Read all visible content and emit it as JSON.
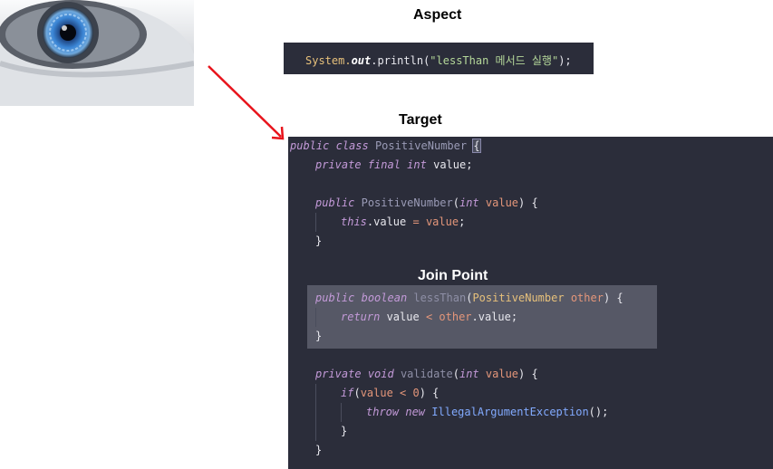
{
  "labels": {
    "aspect": "Aspect",
    "target": "Target",
    "join_point": "Join Point"
  },
  "aspect_code": {
    "part1": "System.",
    "part2": "out",
    "part3": ".println(",
    "part4": "\"lessThan 메서드 실행\"",
    "part5": ");"
  },
  "target_code": {
    "l1": {
      "kw1": "public",
      "kw2": "class",
      "name": "PositiveNumber",
      "brace": "{"
    },
    "l2": {
      "kw1": "private",
      "kw2": "final",
      "kw3": "int",
      "rest": "value;"
    },
    "l4": {
      "kw1": "public",
      "name": "PositiveNumber",
      "open": "(",
      "kw2": "int",
      "param": "value",
      "close": ") {"
    },
    "l5": {
      "kw1": "this",
      "mid": ".value ",
      "op": "=",
      "param": " value",
      "end": ";"
    },
    "l6": {
      "brace": "}"
    },
    "l8": {
      "kw1": "public",
      "kw2": "boolean",
      "name": "lessThan",
      "open": "(",
      "type": "PositiveNumber",
      "param": " other",
      "close": ") {"
    },
    "l9": {
      "kw1": "return",
      "mid": " value ",
      "op": "<",
      "param": " other",
      "end": ".value;"
    },
    "l10": {
      "brace": "}"
    },
    "l12": {
      "kw1": "private",
      "kw2": "void",
      "name": "validate",
      "open": "(",
      "kw3": "int",
      "param": " value",
      "close": ") {"
    },
    "l13": {
      "kw1": "if",
      "open": "(",
      "param": "value",
      "op": " < ",
      "num": "0",
      "close": ") {"
    },
    "l14": {
      "kw1": "throw",
      "kw2": "new",
      "fn": "IllegalArgumentException",
      "end": "();"
    },
    "l15": {
      "brace": "}"
    },
    "l16": {
      "brace": "}"
    }
  }
}
